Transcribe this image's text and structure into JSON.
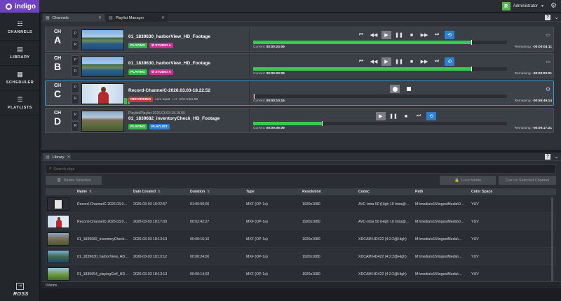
{
  "app": {
    "name": "indigo",
    "user": "Administrator",
    "user_initial": "R"
  },
  "sidebar": {
    "items": [
      {
        "label": "CHANNELS",
        "icon": "grid-icon"
      },
      {
        "label": "LIBRARY",
        "icon": "library-icon"
      },
      {
        "label": "SCHEDULER",
        "icon": "calendar-icon"
      },
      {
        "label": "PLAYLISTS",
        "icon": "playlist-icon"
      }
    ],
    "brand": "ROSS"
  },
  "top_tabs": [
    {
      "label": "Channels"
    },
    {
      "label": "Playlist Manager"
    }
  ],
  "channels": [
    {
      "prefix": "CH",
      "letter": "A",
      "clip": "01_1839630_harborView_HD_Footage",
      "badges": [
        "PLAYING",
        "STUDIO A"
      ],
      "current_label": "Current:",
      "current": "00:00:24:09",
      "remaining_label": "Remaining:",
      "remaining": "-00:00:04:11",
      "progress": 0.86
    },
    {
      "prefix": "CH",
      "letter": "B",
      "clip": "01_1839630_harborView_HD_Footage",
      "badges": [
        "PLAYING",
        "STUDIO A"
      ],
      "current_label": "Current:",
      "current": "00:00:20:09",
      "remaining_label": "Remaining:",
      "remaining": "-00:00:03:21",
      "progress": 0.86
    },
    {
      "prefix": "CH",
      "letter": "C",
      "clip": "Record-ChannelC-2026.03.03-18.22.52",
      "badges": [
        "RECORDING"
      ],
      "live_input": "Live Input",
      "codec": "AVC Intra 50",
      "current_label": "Current:",
      "current": "00:00:10;15",
      "remaining_label": "Remaining:",
      "remaining": "-00:59:49;14",
      "progress": 0.003
    },
    {
      "prefix": "CH",
      "letter": "D",
      "playlist": "Playlist/Playlist-2026.03.03-18.18.55",
      "clip": "01_1839682_inventoryCheck_HD_Footage",
      "badges": [
        "PLAYING",
        "PLAYLIST"
      ],
      "current_label": "Current:",
      "current": "00:00:06:09",
      "remaining_label": "Remaining:",
      "remaining": "-00:00:17:21",
      "progress": 0.27
    }
  ],
  "library": {
    "tab": "Library",
    "search_placeholder": "Search clips",
    "delete_label": "Delete Selected",
    "lock_label": "Lock Media",
    "cue_label": "Cue on Selected Channel",
    "columns": [
      "Name",
      "Date Created",
      "Duration",
      "Type",
      "Resolution",
      "Codec",
      "Path",
      "Color Space"
    ],
    "rows": [
      [
        "Record-ChannelC-2026.03.0…",
        "2026-03-03 18:22:57",
        "01:00:00;00",
        "MXF (OP-1a)",
        "1920x1080",
        "AVC-Intra 50 (High 10 Intra@…",
        "M:\\media\\v15\\ingestMedia\\0…",
        "YUV"
      ],
      [
        "Record-ChannelC-2026.03.0…",
        "2026-03-03 18:17:03",
        "00:02:42;27",
        "MXF (OP-1a)",
        "1920x1080",
        "AVC-Intra 50 (High 10 Intra@…",
        "M:\\media\\v15\\ingestMedia\\0…",
        "YUV"
      ],
      [
        "01_1839682_inventoryCheck…",
        "2026-03-03 18:13:13",
        "00:00:16;10",
        "MXF (OP-1a)",
        "1920x1080",
        "XDCAM HD422 (4:2:2@High)",
        "M:\\media\\v15\\ingestMedia\\…",
        "YUV"
      ],
      [
        "01_1839630_harborView_HD…",
        "2026-03-03 18:13:12",
        "00:00:24;00",
        "MXF (OP-1a)",
        "1920x1080",
        "XDCAM HD422 (4:2:2@High)",
        "M:\\media\\v15\\ingestMedia\\…",
        "YUV"
      ],
      [
        "01_1839654_playingGolf_HD…",
        "2026-03-03 18:13:13",
        "00:00:14;03",
        "MXF (OP-1a)",
        "1920x1080",
        "XDCAM HD422 (4:2:2@High)",
        "M:\\media\\v15\\ingestMedia\\…",
        "YUV"
      ]
    ],
    "status": "0 items"
  },
  "colors": {
    "accent": "#6f42c1",
    "playing": "#36b24a",
    "recording": "#c8363c",
    "studio": "#c2338f",
    "playlist": "#2f7fd0",
    "progress": "#3bc74d"
  }
}
